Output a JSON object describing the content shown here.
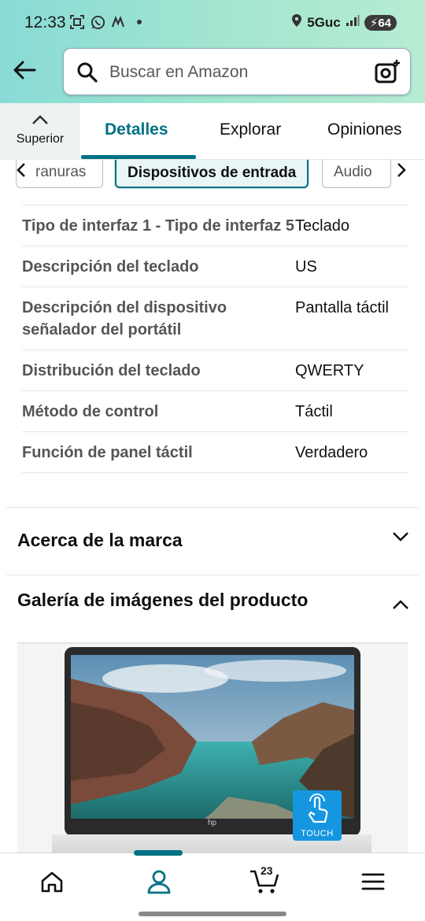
{
  "status_bar": {
    "time": "12:33",
    "network": "5Guc",
    "battery": "64",
    "icons": [
      "scan-icon",
      "whatsapp-icon",
      "m-app-icon",
      "dot-icon",
      "location-icon",
      "signal-icon"
    ]
  },
  "search": {
    "placeholder": "Buscar en Amazon"
  },
  "tabs": {
    "superior_label": "Superior",
    "items": [
      {
        "label": "Detalles",
        "active": true
      },
      {
        "label": "Explorar",
        "active": false
      },
      {
        "label": "Opiniones",
        "active": false
      }
    ]
  },
  "chips": {
    "items": [
      {
        "label": "ranuras",
        "active": false
      },
      {
        "label": "Dispositivos de entrada",
        "active": true
      },
      {
        "label": "Audio",
        "active": false
      }
    ]
  },
  "details": {
    "rows": [
      {
        "key": "Tipo de interfaz 1 - Tipo de interfaz 5",
        "value": "Teclado"
      },
      {
        "key": "Descripción del teclado",
        "value": "US"
      },
      {
        "key": "Descripción del dispositivo señalador del portátil",
        "value": "Pantalla táctil"
      },
      {
        "key": "Distribución del teclado",
        "value": "QWERTY"
      },
      {
        "key": "Método de control",
        "value": "Táctil"
      },
      {
        "key": "Función de panel táctil",
        "value": "Verdadero"
      }
    ]
  },
  "sections": {
    "brand": "Acerca de la marca",
    "gallery": "Galería de imágenes del producto"
  },
  "gallery": {
    "badge_label": "TOUCH",
    "brand_logo": "hp"
  },
  "bottom_nav": {
    "cart_count": "23",
    "items": [
      "home-icon",
      "account-icon",
      "cart-icon",
      "menu-icon"
    ],
    "active": "account-icon"
  },
  "colors": {
    "accent": "#007185",
    "header_start": "#88dbd6",
    "header_end": "#b7ecd2"
  }
}
